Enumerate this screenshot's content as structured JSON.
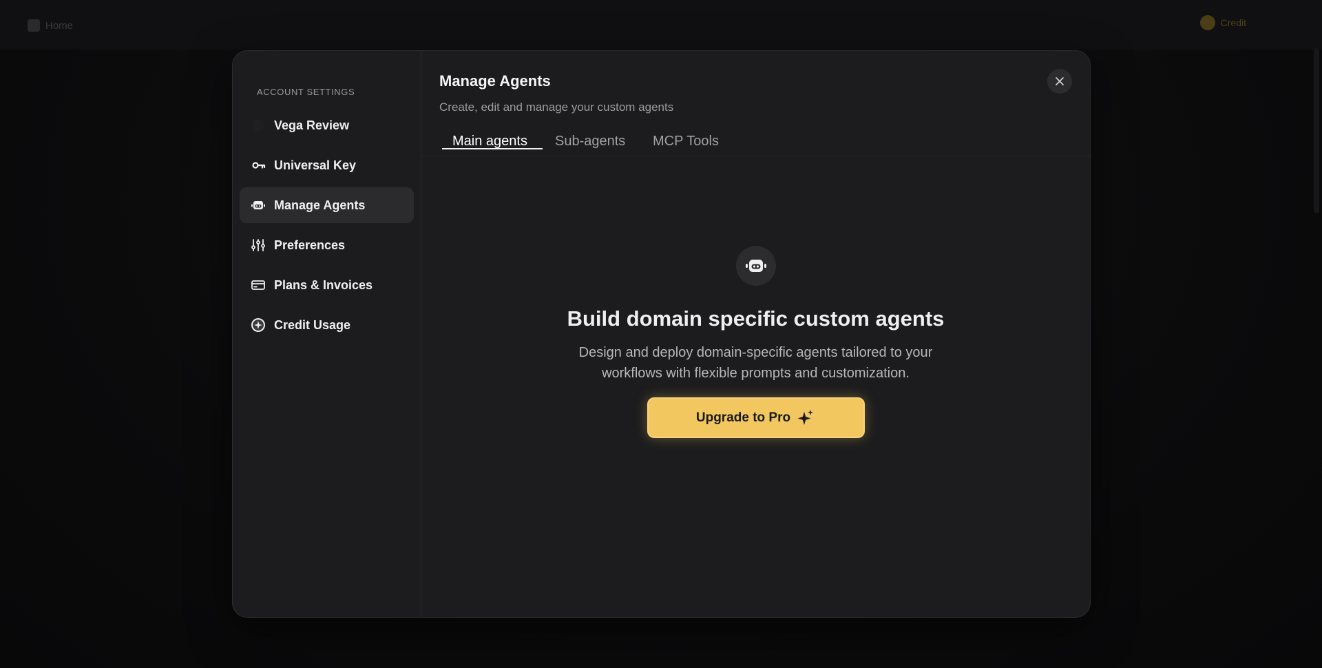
{
  "background": {
    "home_label": "Home",
    "credits_label": "Credit"
  },
  "sidebar": {
    "heading": "ACCOUNT SETTINGS",
    "items": [
      {
        "label": "Vega Review",
        "icon": "avatar-icon"
      },
      {
        "label": "Universal Key",
        "icon": "key-icon"
      },
      {
        "label": "Manage Agents",
        "icon": "robot-icon",
        "active": true
      },
      {
        "label": "Preferences",
        "icon": "sliders-icon"
      },
      {
        "label": "Plans & Invoices",
        "icon": "credit-card-icon"
      },
      {
        "label": "Credit Usage",
        "icon": "credit-coin-icon"
      }
    ]
  },
  "main": {
    "title": "Manage Agents",
    "subtitle": "Create, edit and manage your custom agents",
    "tabs": [
      {
        "label": "Main agents",
        "active": true
      },
      {
        "label": "Sub-agents",
        "active": false
      },
      {
        "label": "MCP Tools",
        "active": false
      }
    ],
    "empty_state": {
      "title": "Build domain specific custom agents",
      "description": "Design and deploy domain-specific agents tailored to your workflows with flexible prompts and customization.",
      "button_label": "Upgrade to Pro"
    }
  },
  "colors": {
    "modal_bg": "#1c1c1e",
    "active_item_bg": "#2b2b2e",
    "accent": "#f2c760"
  }
}
